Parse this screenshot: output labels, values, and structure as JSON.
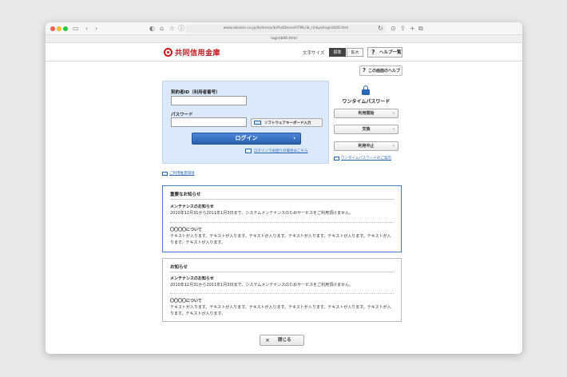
{
  "browser": {
    "url": "www.ebinkin.co.jp/ib/demo/ib/PutDemo/HTML/ib_rinkyo/loginib00.htm",
    "tab_title": "loginib00.html"
  },
  "header": {
    "logo_text": "共同信用金庫",
    "font_size_label": "文字サイズ",
    "font_size_standard": "標準",
    "font_size_large": "拡大",
    "help_list_label": "ヘルプ一覧"
  },
  "page_help_label": "この画面のヘルプ",
  "login": {
    "id_label": "契約者ID（利用者番号）",
    "id_value": "",
    "password_label": "パスワード",
    "password_value": "",
    "software_keyboard_label": "ソフトウェアキーボード入力",
    "login_button": "ログイン",
    "trouble_link": "ログインでお困りの場合はこちら"
  },
  "otp": {
    "title": "ワンタイムパスワード",
    "start_button": "利用開始",
    "exchange_button": "交換",
    "stop_button": "利用中止",
    "guide_link": "ワンタイムパスワードのご案内"
  },
  "environment_link": "ご利用推奨環境",
  "important_notice": {
    "title": "重要なお知らせ",
    "items": [
      {
        "heading": "メンテナンスのお知らせ",
        "body": "2010年12月31から2011年1月3日まで、システムメンテナンスのためサービスをご利用頂けません。"
      },
      {
        "heading": "〇〇〇〇について",
        "body": "テキストが入ります。テキストが入ります。テキストが入ります。テキストが入ります。テキストが入ります。テキストが入ります。テキストが入ります。"
      }
    ]
  },
  "notice": {
    "title": "お知らせ",
    "items": [
      {
        "heading": "メンテナンスのお知らせ",
        "body": "2010年12月31から2011年1月3日まで、システムメンテナンスのためサービスをご利用頂けません。"
      },
      {
        "heading": "〇〇〇〇について",
        "body": "テキストが入ります。テキストが入ります。テキストが入ります。テキストが入ります。テキストが入ります。テキストが入ります。テキストが入ります。"
      }
    ]
  },
  "close_button": "閉じる",
  "colors": {
    "brand_red": "#c8161d",
    "login_blue": "#2a5fb0",
    "link_blue": "#2b67b8",
    "login_panel_bg": "#dbe9fa"
  }
}
